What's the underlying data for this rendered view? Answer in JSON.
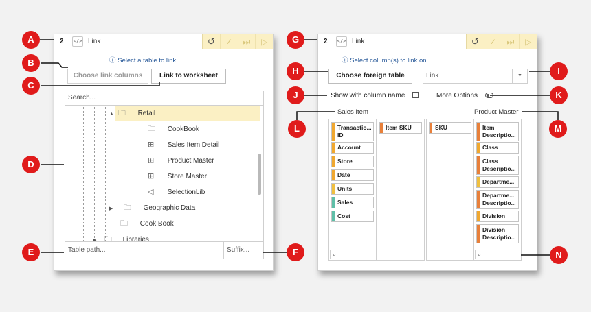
{
  "left_panel": {
    "number": "2",
    "link_icon": "</>",
    "title": "Link",
    "actions": [
      "undo-icon",
      "check-icon",
      "skip-icon",
      "play-icon"
    ],
    "info": "ⓘ Select a table to link.",
    "choose_link_columns": "Choose link columns",
    "link_to_worksheet": "Link to worksheet",
    "search_placeholder": "Search...",
    "tree": [
      {
        "label": "Retail",
        "icon": "folder-icon",
        "caret": "▲",
        "selected": true
      },
      {
        "label": "CookBook",
        "icon": "folder-icon"
      },
      {
        "label": "Sales Item Detail",
        "icon": "table-icon"
      },
      {
        "label": "Product Master",
        "icon": "table-icon"
      },
      {
        "label": "Store Master",
        "icon": "table-icon"
      },
      {
        "label": "SelectionLib",
        "icon": "send-icon"
      },
      {
        "label": "Geographic Data",
        "icon": "folder-icon",
        "caret": "▶"
      },
      {
        "label": "Cook Book",
        "icon": "folder-icon"
      },
      {
        "label": "Libraries",
        "icon": "folder-icon",
        "caret": "▶"
      }
    ],
    "table_path_placeholder": "Table path...",
    "suffix_placeholder": "Suffix..."
  },
  "right_panel": {
    "number": "2",
    "link_icon": "</>",
    "title": "Link",
    "actions": [
      "undo-icon",
      "check-icon",
      "skip-icon",
      "play-icon"
    ],
    "info": "ⓘ Select column(s) to link on.",
    "choose_foreign_table": "Choose foreign table",
    "link_select": "Link",
    "show_with_column_name": "Show with column name",
    "more_options": "More Options",
    "sales_item_label": "Sales Item",
    "product_master_label": "Product Master",
    "col1": [
      {
        "label": "Transactio... ID",
        "color": "#f0a830"
      },
      {
        "label": "Account",
        "color": "#f0a830"
      },
      {
        "label": "Store",
        "color": "#f0a830"
      },
      {
        "label": "Date",
        "color": "#f0a830"
      },
      {
        "label": "Units",
        "color": "#f0c040"
      },
      {
        "label": "Sales",
        "color": "#5fbfa8"
      },
      {
        "label": "Cost",
        "color": "#5fbfa8"
      }
    ],
    "col2": [
      {
        "label": "Item SKU",
        "color": "#e8803a"
      }
    ],
    "col3": [
      {
        "label": "SKU",
        "color": "#e8803a"
      }
    ],
    "col4": [
      {
        "label": "Item Descriptio...",
        "color": "#e8803a"
      },
      {
        "label": "Class",
        "color": "#f0a830"
      },
      {
        "label": "Class Descriptio...",
        "color": "#e8803a"
      },
      {
        "label": "Departme...",
        "color": "#f0c040"
      },
      {
        "label": "Departme... Descriptio...",
        "color": "#e8803a"
      },
      {
        "label": "Division",
        "color": "#f0a830"
      },
      {
        "label": "Division Descriptio...",
        "color": "#e8803a"
      }
    ]
  },
  "callouts": [
    "A",
    "B",
    "C",
    "D",
    "E",
    "F",
    "G",
    "H",
    "I",
    "J",
    "K",
    "L",
    "M",
    "N"
  ]
}
